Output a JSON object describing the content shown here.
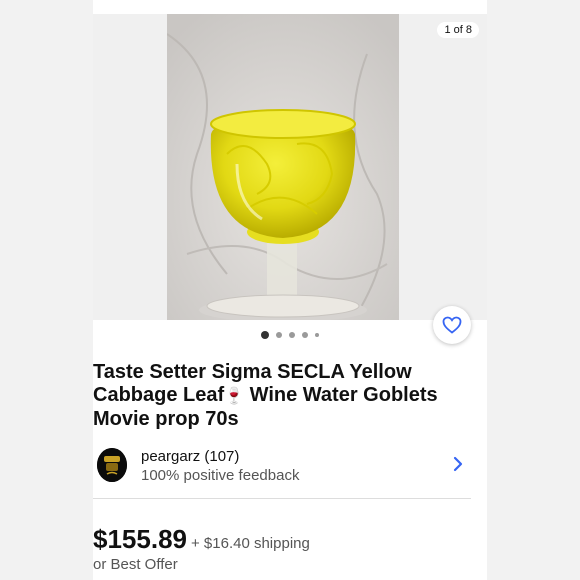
{
  "gallery": {
    "counter": "1 of 8",
    "image_alt": "Yellow cabbage leaf wine goblet",
    "dots": [
      true,
      false,
      false,
      false,
      false
    ]
  },
  "listing": {
    "title_part1": "Taste Setter Sigma SECLA Yellow Cabbage Leaf",
    "title_emoji": "🍷",
    "title_part2": " Wine Water Goblets Movie prop 70s"
  },
  "seller": {
    "name": "peargarz (107)",
    "feedback": "100% positive feedback"
  },
  "pricing": {
    "price": "$155.89",
    "shipping": "+ $16.40 shipping",
    "offer": "or Best Offer"
  },
  "colors": {
    "accent": "#3665f3",
    "text": "#111111",
    "muted": "#555555"
  }
}
